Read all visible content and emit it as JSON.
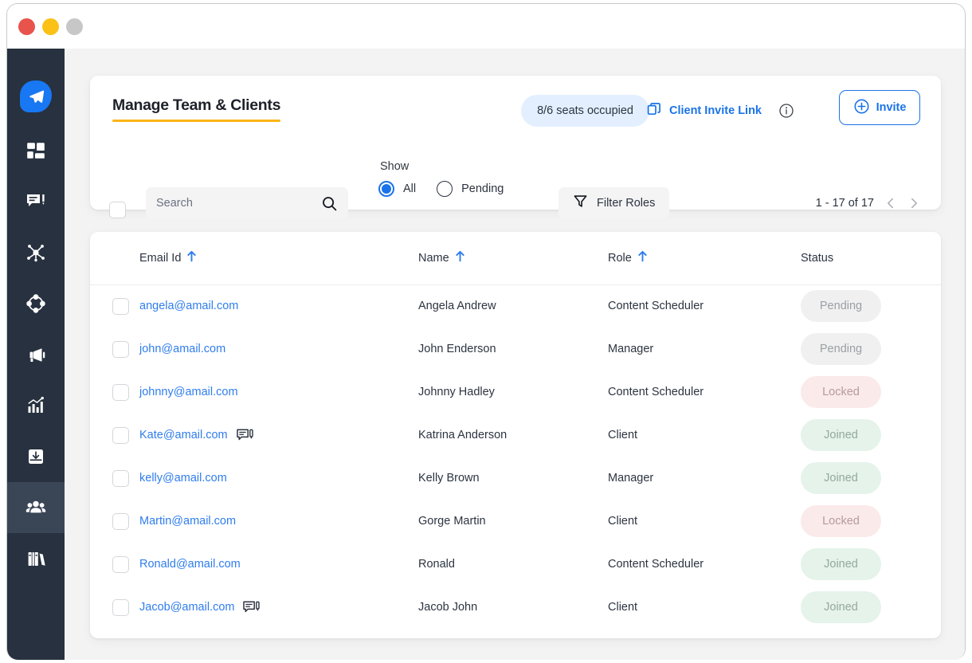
{
  "window": {
    "traffic_lights": [
      "close",
      "minimize",
      "maximize"
    ]
  },
  "sidebar": {
    "items": [
      {
        "id": "brand",
        "icon": "paper-plane-icon",
        "label": "",
        "active": false
      },
      {
        "id": "dashboard",
        "icon": "grid-dashboard-icon",
        "label": "",
        "active": false
      },
      {
        "id": "messages",
        "icon": "chat-compose-icon",
        "label": "",
        "active": false
      },
      {
        "id": "network",
        "icon": "network-nodes-icon",
        "label": "",
        "active": false
      },
      {
        "id": "engage",
        "icon": "circle-diamond-icon",
        "label": "",
        "active": false
      },
      {
        "id": "campaigns",
        "icon": "megaphone-icon",
        "label": "",
        "active": false
      },
      {
        "id": "analytics",
        "icon": "bar-chart-growth-icon",
        "label": "",
        "active": false
      },
      {
        "id": "downloads",
        "icon": "inbox-download-icon",
        "label": "",
        "active": false
      },
      {
        "id": "team",
        "icon": "people-group-icon",
        "label": "",
        "active": true
      },
      {
        "id": "library",
        "icon": "books-library-icon",
        "label": "",
        "active": false
      }
    ]
  },
  "header": {
    "title": "Manage Team & Clients",
    "seats_chip": "8/6 seats occupied",
    "client_invite_link": "Client Invite Link",
    "info_tooltip_icon": "info-circle-icon",
    "copy_icon": "copy-icon",
    "invite_button": "Invite",
    "invite_plus_icon": "plus-circle-icon"
  },
  "filters": {
    "select_all_checked": false,
    "search": {
      "value": "",
      "placeholder": "Search",
      "icon": "search-icon"
    },
    "show_label": "Show",
    "radios": [
      {
        "id": "all",
        "label": "All",
        "selected": true
      },
      {
        "id": "pending",
        "label": "Pending",
        "selected": false
      }
    ],
    "filter_roles": {
      "label": "Filter Roles",
      "icon": "funnel-filter-icon"
    },
    "pagination": {
      "range": "1 - 17 of 17",
      "prev_icon": "chevron-left-icon",
      "next_icon": "chevron-right-icon"
    }
  },
  "table": {
    "columns": [
      {
        "key": "checkbox",
        "label": "",
        "sortable": false
      },
      {
        "key": "email",
        "label": "Email Id",
        "sortable": true
      },
      {
        "key": "name",
        "label": "Name",
        "sortable": true
      },
      {
        "key": "role",
        "label": "Role",
        "sortable": true
      },
      {
        "key": "status",
        "label": "Status",
        "sortable": false
      }
    ],
    "rows": [
      {
        "email": "angela@amail.com",
        "has_note": false,
        "name": "Angela Andrew",
        "role": "Content Scheduler",
        "status": "Pending",
        "status_kind": "pending"
      },
      {
        "email": "john@amail.com",
        "has_note": false,
        "name": "John Enderson",
        "role": "Manager",
        "status": "Pending",
        "status_kind": "pending"
      },
      {
        "email": "johnny@amail.com",
        "has_note": false,
        "name": "Johnny Hadley",
        "role": "Content Scheduler",
        "status": "Locked",
        "status_kind": "locked"
      },
      {
        "email": "Kate@amail.com",
        "has_note": true,
        "name": "Katrina Anderson",
        "role": "Client",
        "status": "Joined",
        "status_kind": "joined"
      },
      {
        "email": "kelly@amail.com",
        "has_note": false,
        "name": "Kelly Brown",
        "role": "Manager",
        "status": "Joined",
        "status_kind": "joined"
      },
      {
        "email": "Martin@amail.com",
        "has_note": false,
        "name": "Gorge Martin",
        "role": "Client",
        "status": "Locked",
        "status_kind": "locked"
      },
      {
        "email": "Ronald@amail.com",
        "has_note": false,
        "name": "Ronald",
        "role": "Content Scheduler",
        "status": "Joined",
        "status_kind": "joined"
      },
      {
        "email": "Jacob@amail.com",
        "has_note": true,
        "name": "Jacob John",
        "role": "Client",
        "status": "Joined",
        "status_kind": "joined"
      }
    ],
    "note_icon": "chat-note-icon"
  },
  "colors": {
    "sidebar_bg": "#27313f",
    "sidebar_active": "#3a4556",
    "accent_blue": "#1a73e8",
    "link_blue": "#2f7ded",
    "title_underline": "#fbb516",
    "chip_bg": "#e3efff",
    "page_bg": "#f3f3f3",
    "badge_pending_bg": "#f0f0f0",
    "badge_locked_bg": "#fbeaea",
    "badge_joined_bg": "#e5f3ea"
  }
}
